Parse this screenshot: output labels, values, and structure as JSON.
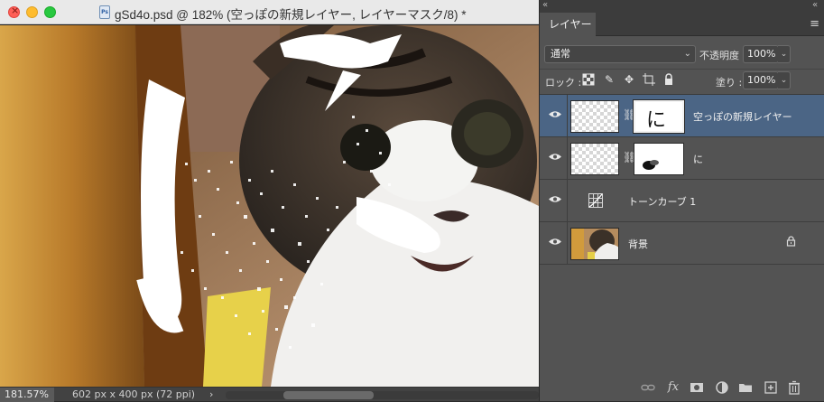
{
  "document": {
    "title": "gSd4o.psd @ 182% (空っぽの新規レイヤー, レイヤーマスク/8) *",
    "file_icon": "Ps",
    "zoom": "181.57%",
    "info": "602 px x 400 px (72 ppi)",
    "info_arrow": "›"
  },
  "panel": {
    "tab": "レイヤー",
    "collapse_left": "«",
    "collapse_right": "«",
    "menu_icon": "≡",
    "blend_mode": "通常",
    "opacity_label": "不透明度 :",
    "opacity_value": "100%",
    "lock_label": "ロック :",
    "fill_label": "塗り :",
    "fill_value": "100%"
  },
  "layers": [
    {
      "name": "空っぽの新規レイヤー",
      "type": "pixel+mask",
      "selected": true,
      "mask_text": "に"
    },
    {
      "name": "に",
      "type": "pixel+mask",
      "selected": false
    },
    {
      "name": "トーンカーブ 1",
      "type": "adjustment",
      "selected": false
    },
    {
      "name": "背景",
      "type": "background",
      "selected": false,
      "locked": true
    }
  ],
  "colors": {
    "selected_layer": "#4b6585",
    "panel_bg": "#535353",
    "titlebar_bg": "#e9e9e9"
  }
}
